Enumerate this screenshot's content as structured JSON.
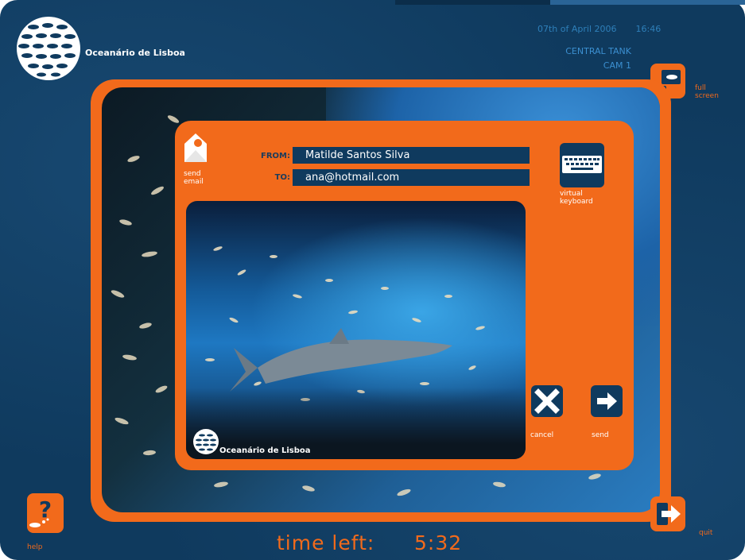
{
  "app": {
    "brand": "Oceanário de Lisboa",
    "date": "07th of April 2006",
    "time": "16:46",
    "tank": "CENTRAL TANK",
    "camera": "CAM 1"
  },
  "email_panel": {
    "title_line1": "send",
    "title_line2": "email",
    "from_label": "FROM:",
    "from_value": "Matilde Santos Silva",
    "to_label": "TO:",
    "to_value": "ana@hotmail.com",
    "keyboard_line1": "virtual",
    "keyboard_line2": "keyboard",
    "photo_caption": "Oceanário de Lisboa",
    "cancel_label": "cancel",
    "send_label": "send"
  },
  "sidebar": {
    "full_screen_line1": "full",
    "full_screen_line2": "screen",
    "quit_label": "quit",
    "help_label": "help"
  },
  "footer": {
    "time_left_label": "time left:",
    "time_left_value": "5:32"
  },
  "colors": {
    "accent": "#f26a1b",
    "background": "#0f3a5e",
    "field": "#0f3a5e"
  }
}
